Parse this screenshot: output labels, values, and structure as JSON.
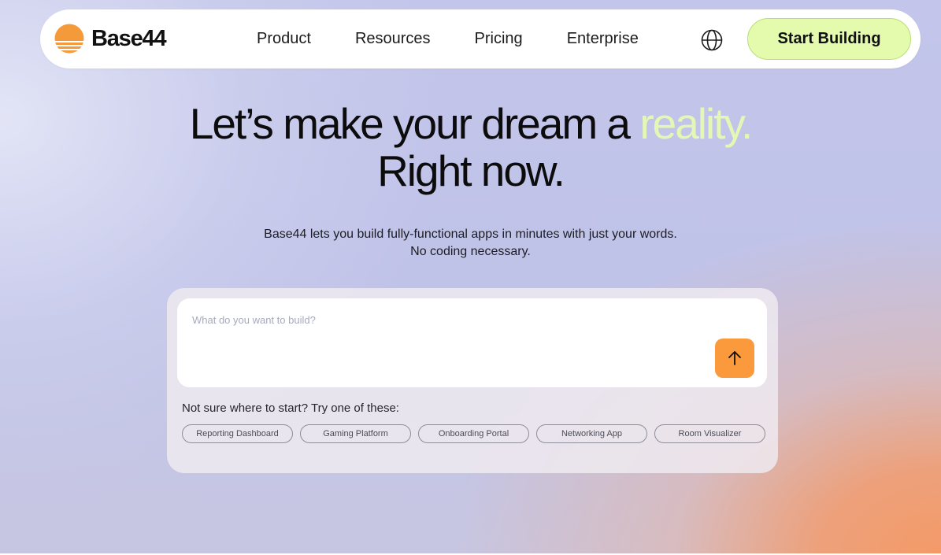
{
  "nav": {
    "brand": "Base44",
    "links": [
      "Product",
      "Resources",
      "Pricing",
      "Enterprise"
    ],
    "cta_label": "Start Building"
  },
  "hero": {
    "title_part1": "Let’s make your dream a ",
    "title_accent": "reality.",
    "title_line2": "Right now.",
    "subtitle_line1": "Base44 lets you build fully-functional apps in minutes with just your words.",
    "subtitle_line2": "No coding necessary."
  },
  "builder": {
    "placeholder": "What do you want to build?",
    "value": "",
    "hint": "Not sure where to start? Try one of these:",
    "suggestions": [
      "Reporting Dashboard",
      "Gaming Platform",
      "Onboarding Portal",
      "Networking App",
      "Room Visualizer"
    ]
  },
  "colors": {
    "accent": "#e5f7b4",
    "cta_bg": "#e4fbae",
    "send_button": "#fa9a3c",
    "logo": "#f59a3a"
  },
  "icons": {
    "logo": "sunset-logo-icon",
    "language": "globe-icon",
    "send": "arrow-up-icon"
  }
}
